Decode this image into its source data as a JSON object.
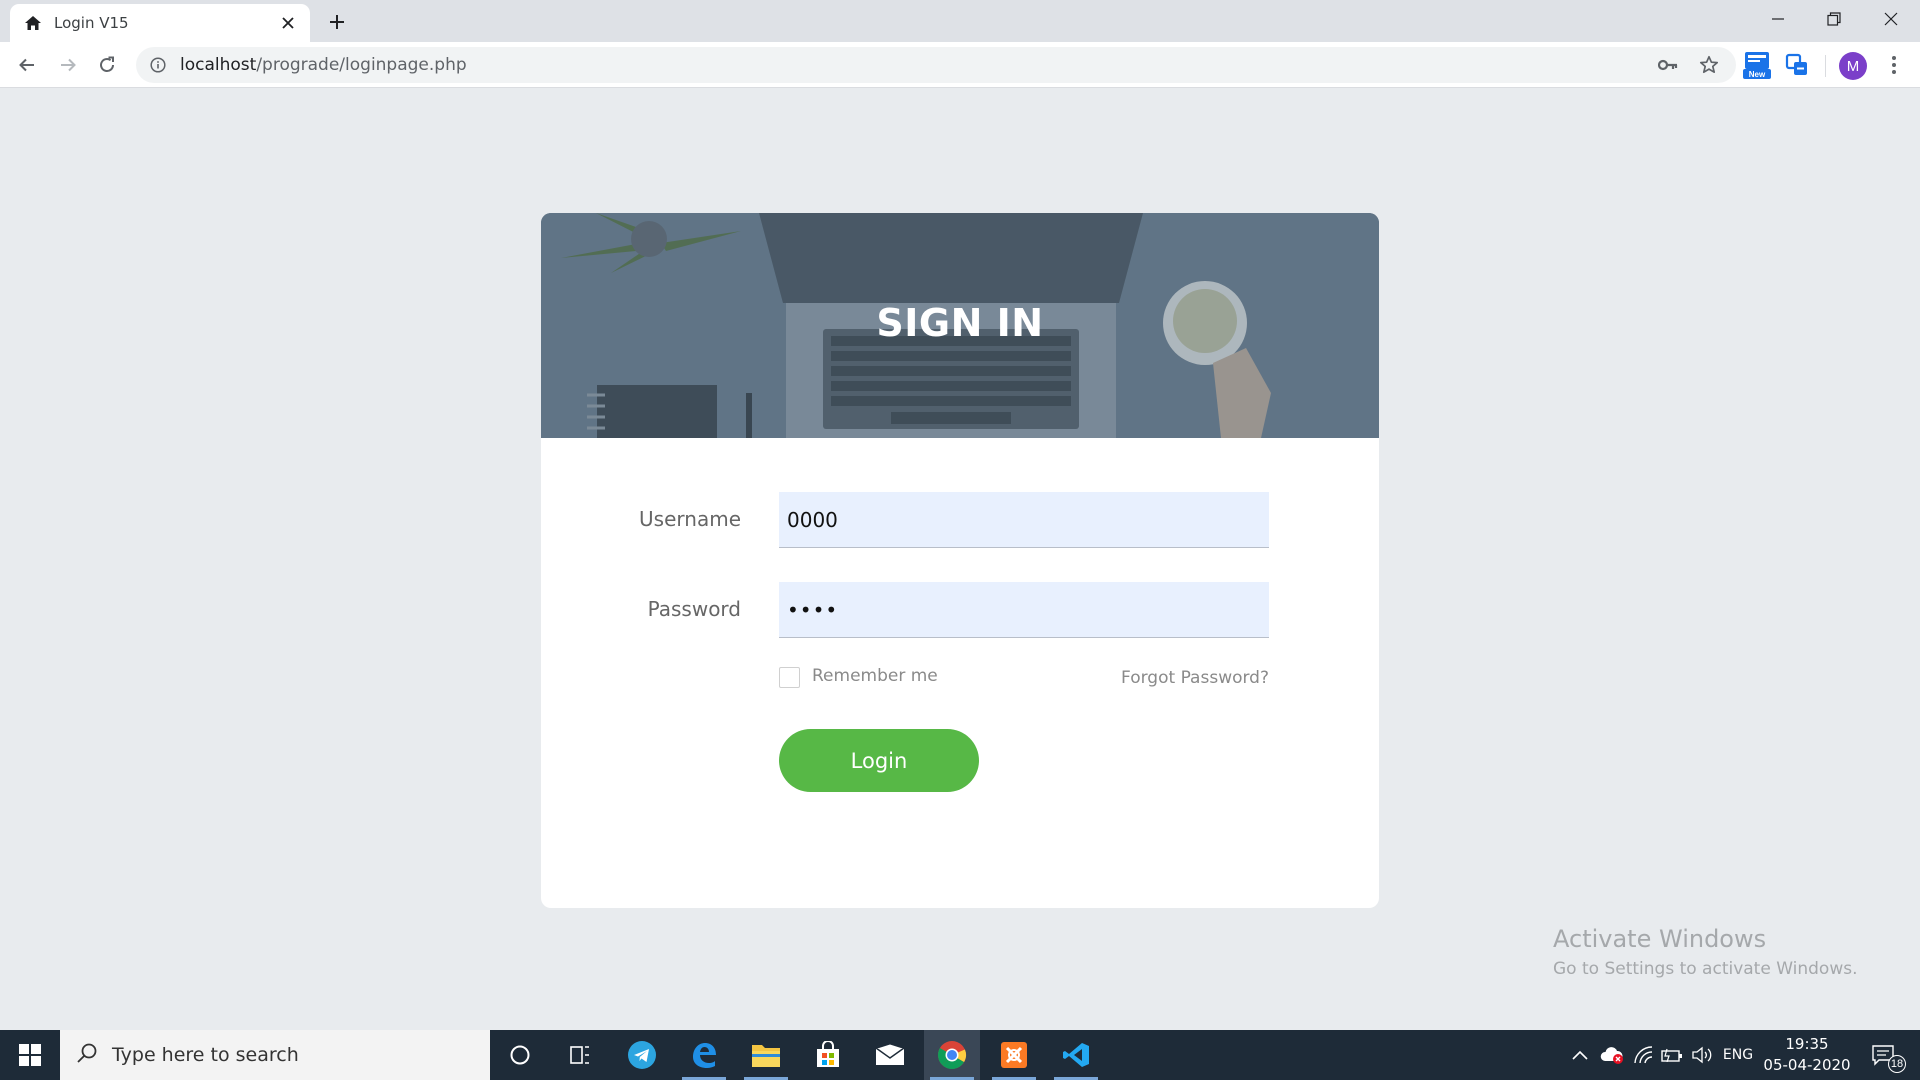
{
  "browser": {
    "tab_title": "Login V15",
    "url_host": "localhost",
    "url_path": "/prograde/loginpage.php",
    "profile_initial": "M",
    "new_badge": "New"
  },
  "login": {
    "heading": "SIGN IN",
    "username_label": "Username",
    "username_value": "0000",
    "password_label": "Password",
    "password_value": "••••",
    "remember_label": "Remember me",
    "forgot_label": "Forgot Password?",
    "login_button": "Login"
  },
  "watermark": {
    "title": "Activate Windows",
    "subtitle": "Go to Settings to activate Windows."
  },
  "taskbar": {
    "search_placeholder": "Type here to search",
    "language": "ENG",
    "time": "19:35",
    "date": "05-04-2020",
    "notification_count": "18"
  },
  "colors": {
    "accent_green": "#57b846",
    "input_bg": "#e8f0fe",
    "hero_overlay": "#5f7284"
  }
}
